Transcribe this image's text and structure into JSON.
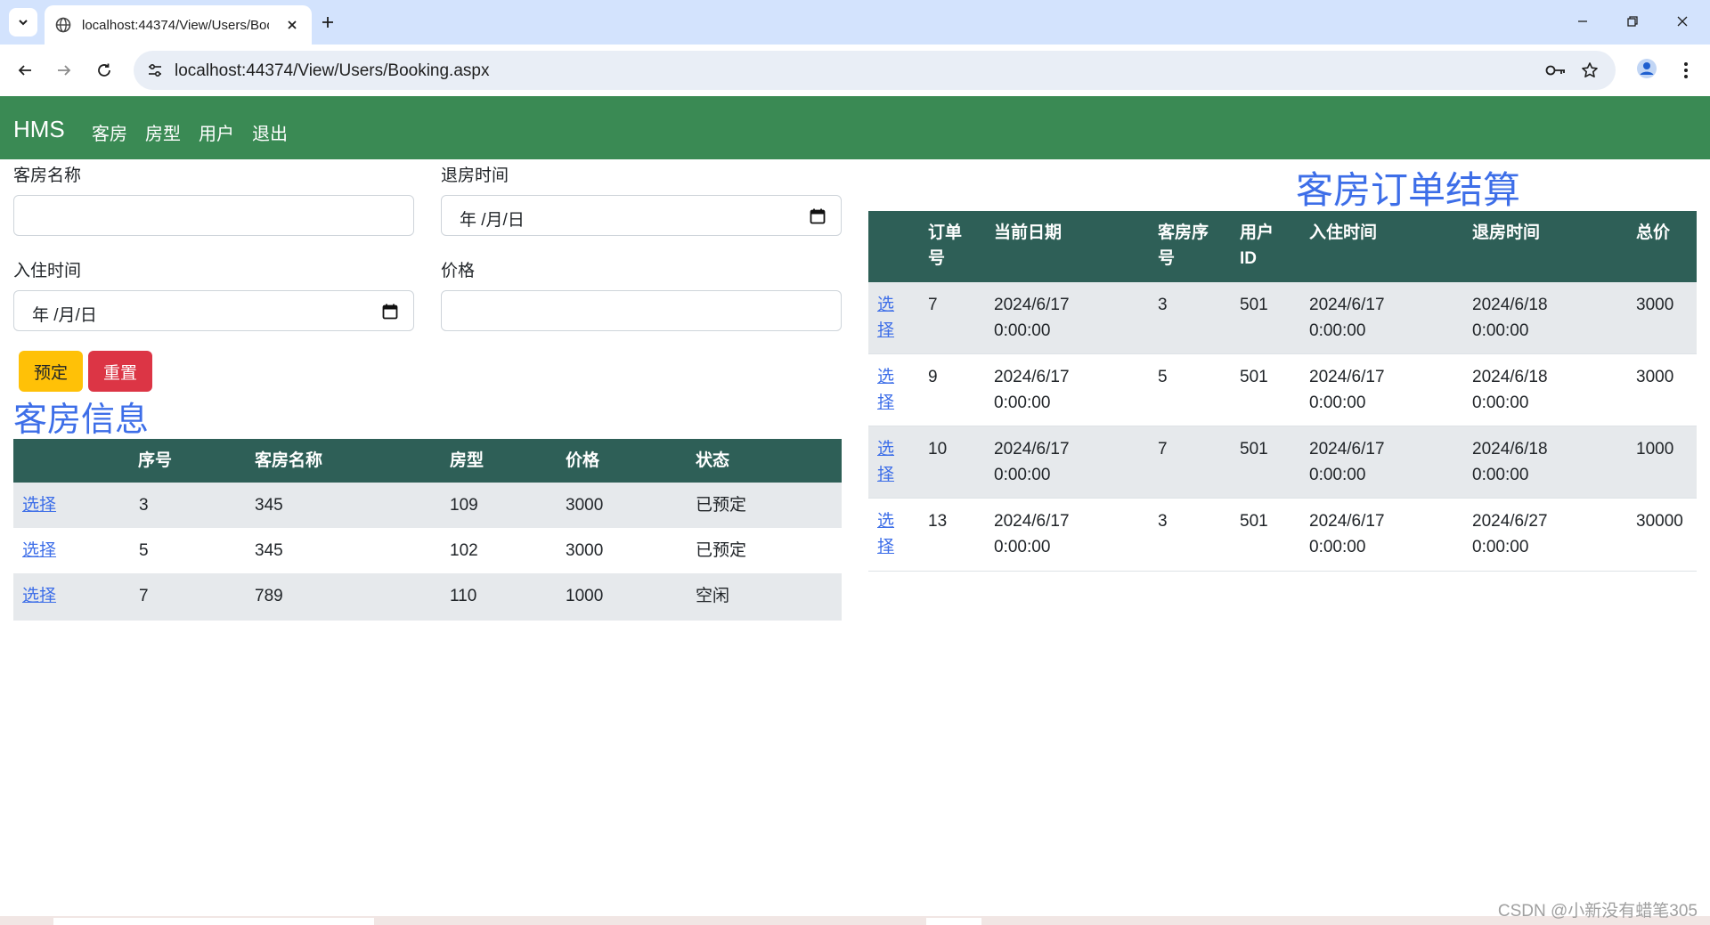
{
  "browser": {
    "tab_title": "localhost:44374/View/Users/Booking.aspx",
    "url": "localhost:44374/View/Users/Booking.aspx"
  },
  "navbar": {
    "brand": "HMS",
    "links": [
      "客房",
      "房型",
      "用户",
      "退出"
    ]
  },
  "form": {
    "room_name_label": "客房名称",
    "room_name_value": "",
    "checkout_label": "退房时间",
    "checkout_value": "年 /月/日",
    "checkin_label": "入住时间",
    "checkin_value": "年 /月/日",
    "price_label": "价格",
    "price_value": "",
    "book_button": "预定",
    "reset_button": "重置"
  },
  "rooms": {
    "title": "客房信息",
    "headers": [
      "",
      "序号",
      "客房名称",
      "房型",
      "价格",
      "状态"
    ],
    "rows": [
      {
        "select": "选择",
        "id": "3",
        "name": "345",
        "type": "109",
        "price": "3000",
        "status": "已预定"
      },
      {
        "select": "选择",
        "id": "5",
        "name": "345",
        "type": "102",
        "price": "3000",
        "status": "已预定"
      },
      {
        "select": "选择",
        "id": "7",
        "name": "789",
        "type": "110",
        "price": "1000",
        "status": "空闲"
      }
    ]
  },
  "orders": {
    "title": "客房订单结算",
    "headers": [
      [
        "",
        ""
      ],
      [
        "订单",
        "号"
      ],
      [
        "当前日期",
        ""
      ],
      [
        "客房序",
        "号"
      ],
      [
        "用户",
        "ID"
      ],
      [
        "入住时间",
        ""
      ],
      [
        "退房时间",
        ""
      ],
      [
        "总价",
        ""
      ]
    ],
    "rows": [
      {
        "select": [
          "选",
          "择"
        ],
        "order_id": "7",
        "date": [
          "2024/6/17",
          "0:00:00"
        ],
        "room_id": "3",
        "user_id": "501",
        "checkin": [
          "2024/6/17",
          "0:00:00"
        ],
        "checkout": [
          "2024/6/18",
          "0:00:00"
        ],
        "total": "3000"
      },
      {
        "select": [
          "选",
          "择"
        ],
        "order_id": "9",
        "date": [
          "2024/6/17",
          "0:00:00"
        ],
        "room_id": "5",
        "user_id": "501",
        "checkin": [
          "2024/6/17",
          "0:00:00"
        ],
        "checkout": [
          "2024/6/18",
          "0:00:00"
        ],
        "total": "3000"
      },
      {
        "select": [
          "选",
          "择"
        ],
        "order_id": "10",
        "date": [
          "2024/6/17",
          "0:00:00"
        ],
        "room_id": "7",
        "user_id": "501",
        "checkin": [
          "2024/6/17",
          "0:00:00"
        ],
        "checkout": [
          "2024/6/18",
          "0:00:00"
        ],
        "total": "1000"
      },
      {
        "select": [
          "选",
          "择"
        ],
        "order_id": "13",
        "date": [
          "2024/6/17",
          "0:00:00"
        ],
        "room_id": "3",
        "user_id": "501",
        "checkin": [
          "2024/6/17",
          "0:00:00"
        ],
        "checkout": [
          "2024/6/27",
          "0:00:00"
        ],
        "total": "30000"
      }
    ]
  },
  "watermark": "CSDN @小新没有蜡笔305"
}
